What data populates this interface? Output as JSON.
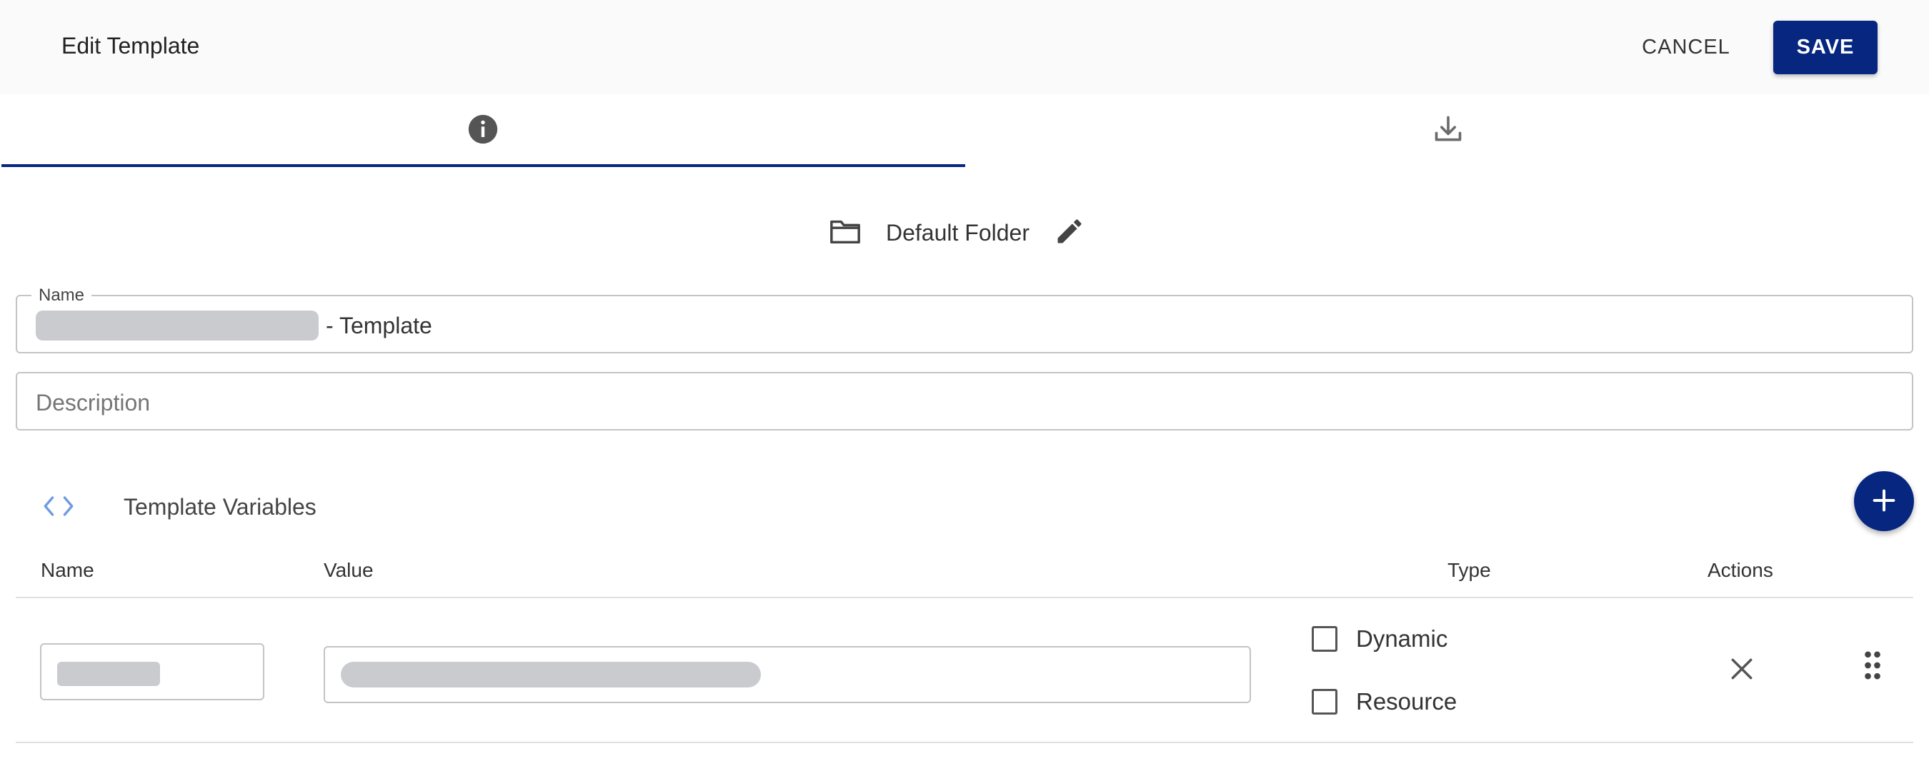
{
  "header": {
    "title": "Edit Template",
    "cancel_label": "CANCEL",
    "save_label": "SAVE"
  },
  "tabs": [
    {
      "icon": "info-icon",
      "active": true
    },
    {
      "icon": "download-icon",
      "active": false
    }
  ],
  "folder": {
    "label": "Default Folder",
    "icon": "folder-icon",
    "edit_icon": "pencil-icon"
  },
  "name_field": {
    "label": "Name",
    "value_suffix": "- Template"
  },
  "description_field": {
    "placeholder": "Description",
    "value": ""
  },
  "template_variables": {
    "title": "Template Variables",
    "icon": "code-icon",
    "add_icon": "plus-icon",
    "columns": {
      "name": "Name",
      "value": "Value",
      "type": "Type",
      "actions": "Actions"
    },
    "rows": [
      {
        "types": [
          {
            "label": "Dynamic",
            "checked": false
          },
          {
            "label": "Resource",
            "checked": false
          }
        ],
        "remove_icon": "close-icon",
        "drag_icon": "drag-handle-icon"
      }
    ]
  },
  "colors": {
    "primary": "#062680",
    "header_bg": "#fafafa",
    "border": "#c4c4c4",
    "redaction": "#cacbcf",
    "code_icon": "#6f9be0"
  }
}
